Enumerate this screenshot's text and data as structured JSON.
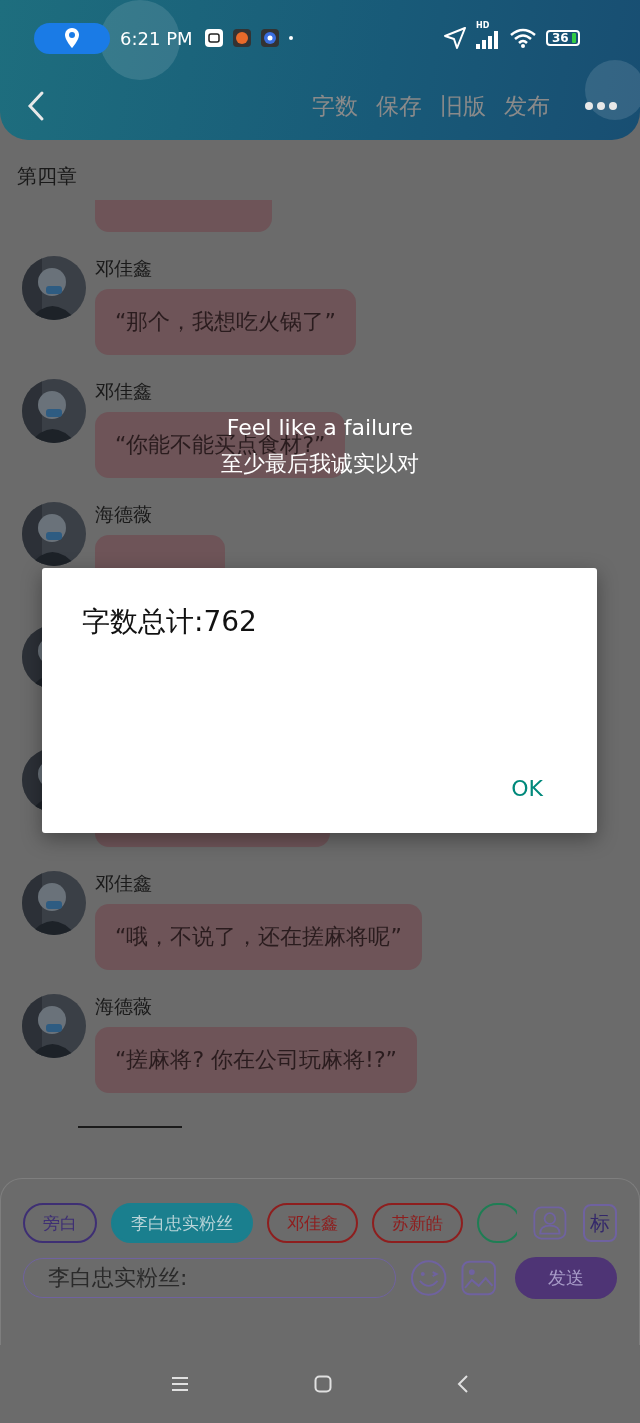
{
  "status_bar": {
    "time": "6:21 PM",
    "network": "HD",
    "battery": "36"
  },
  "toolbar": {
    "actions": [
      "字数",
      "保存",
      "旧版",
      "发布"
    ]
  },
  "chapter_title": "第四章",
  "messages": [
    {
      "kind": "cut"
    },
    {
      "kind": "message",
      "sender": "邓佳鑫",
      "text": "“那个，我想吃火锅了”"
    },
    {
      "kind": "message",
      "sender": "邓佳鑫",
      "text": "“你能不能买点食材?”"
    },
    {
      "kind": "message",
      "sender": "海德薇"
    },
    {
      "kind": "covered"
    },
    {
      "kind": "hidden"
    },
    {
      "kind": "message",
      "sender": "邓佳鑫",
      "text": "“哦，不说了，还在搓麻将呢”"
    },
    {
      "kind": "message",
      "sender": "海德薇",
      "text": "“搓麻将? 你在公司玩麻将!?”"
    }
  ],
  "subtitle": {
    "lines": [
      "Feel like a failure",
      "至少最后我诚实以对"
    ]
  },
  "dialog": {
    "title": "字数总计:762",
    "button": "OK"
  },
  "composer": {
    "chips": [
      {
        "label": "旁白",
        "color": "#3e2f74",
        "selected": false
      },
      {
        "label": "李白忠实粉丝",
        "color": "#1a7f8e",
        "selected": true
      },
      {
        "label": "邓佳鑫",
        "color": "#8e1e1e",
        "selected": false
      },
      {
        "label": "苏新皓",
        "color": "#8e1e1e",
        "selected": false
      },
      {
        "color": "#1e7e54",
        "selected": false
      }
    ],
    "tag_button": "标",
    "input": {
      "value": "李白忠实粉丝:"
    },
    "send": "发送"
  }
}
